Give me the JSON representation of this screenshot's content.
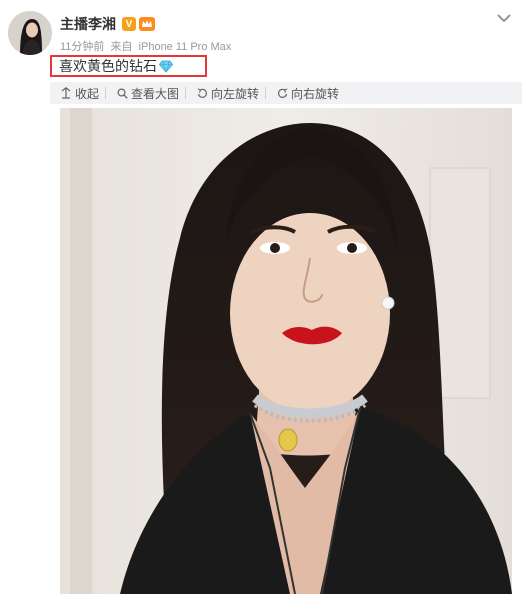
{
  "post": {
    "username": "主播李湘",
    "verified_badge": "V",
    "timestamp": "11分钟前",
    "source_prefix": "来自",
    "source_device": "iPhone 11 Pro Max",
    "text": "喜欢黄色的钻石",
    "highlight_color": "#e2383b"
  },
  "image_toolbar": {
    "collapse_label": "收起",
    "view_large_label": "查看大图",
    "rotate_left_label": "向左旋转",
    "rotate_right_label": "向右旋转"
  },
  "icons": {
    "menu": "chevron-down-icon",
    "emoji": "diamond-icon"
  }
}
